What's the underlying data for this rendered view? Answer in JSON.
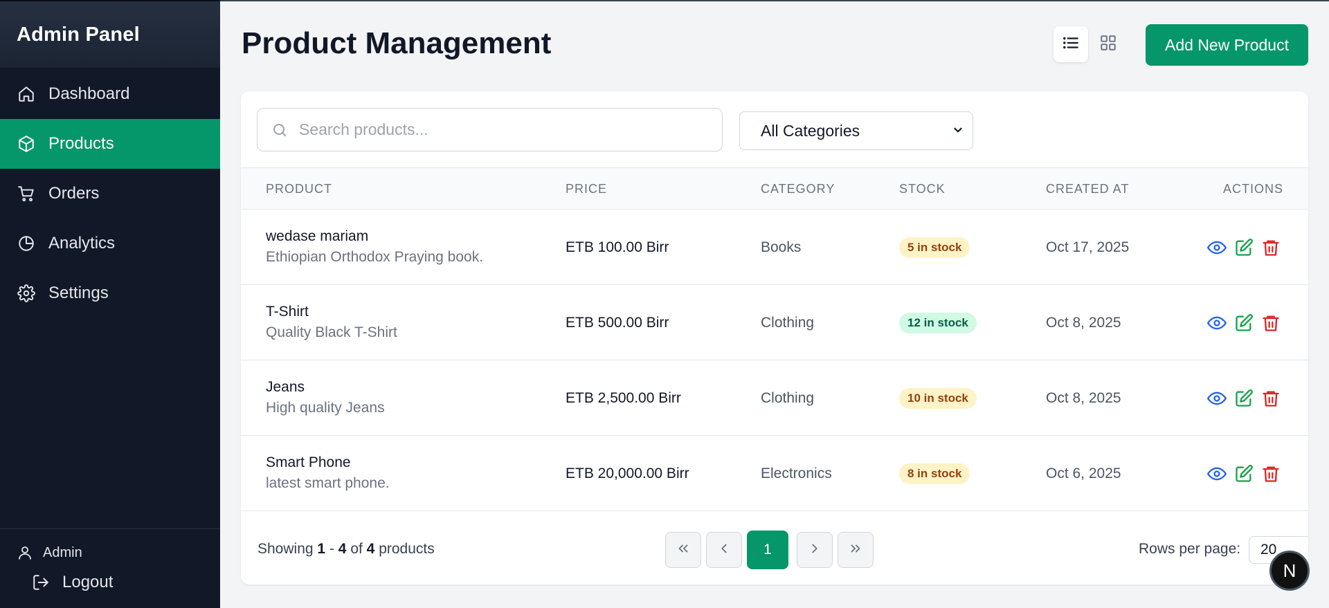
{
  "sidebar": {
    "brand": "Admin Panel",
    "items": [
      {
        "label": "Dashboard",
        "icon": "home-icon"
      },
      {
        "label": "Products",
        "icon": "box-icon",
        "active": true
      },
      {
        "label": "Orders",
        "icon": "cart-icon"
      },
      {
        "label": "Analytics",
        "icon": "pie-chart-icon"
      },
      {
        "label": "Settings",
        "icon": "gear-icon"
      }
    ],
    "user": "Admin",
    "logout": "Logout"
  },
  "header": {
    "title": "Product Management",
    "add_button": "Add New Product"
  },
  "filters": {
    "search_placeholder": "Search products...",
    "search_value": "",
    "category_selected": "All Categories"
  },
  "table": {
    "columns": [
      "PRODUCT",
      "PRICE",
      "CATEGORY",
      "STOCK",
      "CREATED AT",
      "ACTIONS"
    ],
    "rows": [
      {
        "name": "wedase mariam",
        "description": "Ethiopian Orthodox Praying book.",
        "price": "ETB 100.00 Birr",
        "category": "Books",
        "stock": "5 in stock",
        "stock_status": "low",
        "created": "Oct 17, 2025"
      },
      {
        "name": "T-Shirt",
        "description": "Quality Black T-Shirt",
        "price": "ETB 500.00 Birr",
        "category": "Clothing",
        "stock": "12 in stock",
        "stock_status": "ok",
        "created": "Oct 8, 2025"
      },
      {
        "name": "Jeans",
        "description": "High quality Jeans",
        "price": "ETB 2,500.00 Birr",
        "category": "Clothing",
        "stock": "10 in stock",
        "stock_status": "low",
        "created": "Oct 8, 2025"
      },
      {
        "name": "Smart Phone",
        "description": "latest smart phone.",
        "price": "ETB 20,000.00 Birr",
        "category": "Electronics",
        "stock": "8 in stock",
        "stock_status": "low",
        "created": "Oct 6, 2025"
      }
    ]
  },
  "pagination": {
    "showing_prefix": "Showing",
    "range_start": "1",
    "range_sep": "-",
    "range_end": "4",
    "of": "of",
    "total": "4",
    "suffix": "products",
    "current_page": "1",
    "rows_label": "Rows per page:",
    "rows_value": "20"
  },
  "fab_label": "N",
  "colors": {
    "accent": "#059669",
    "sidebar_bg": "#111827",
    "view_icon": "#2563eb",
    "edit_icon": "#16a34a",
    "delete_icon": "#dc2626"
  }
}
